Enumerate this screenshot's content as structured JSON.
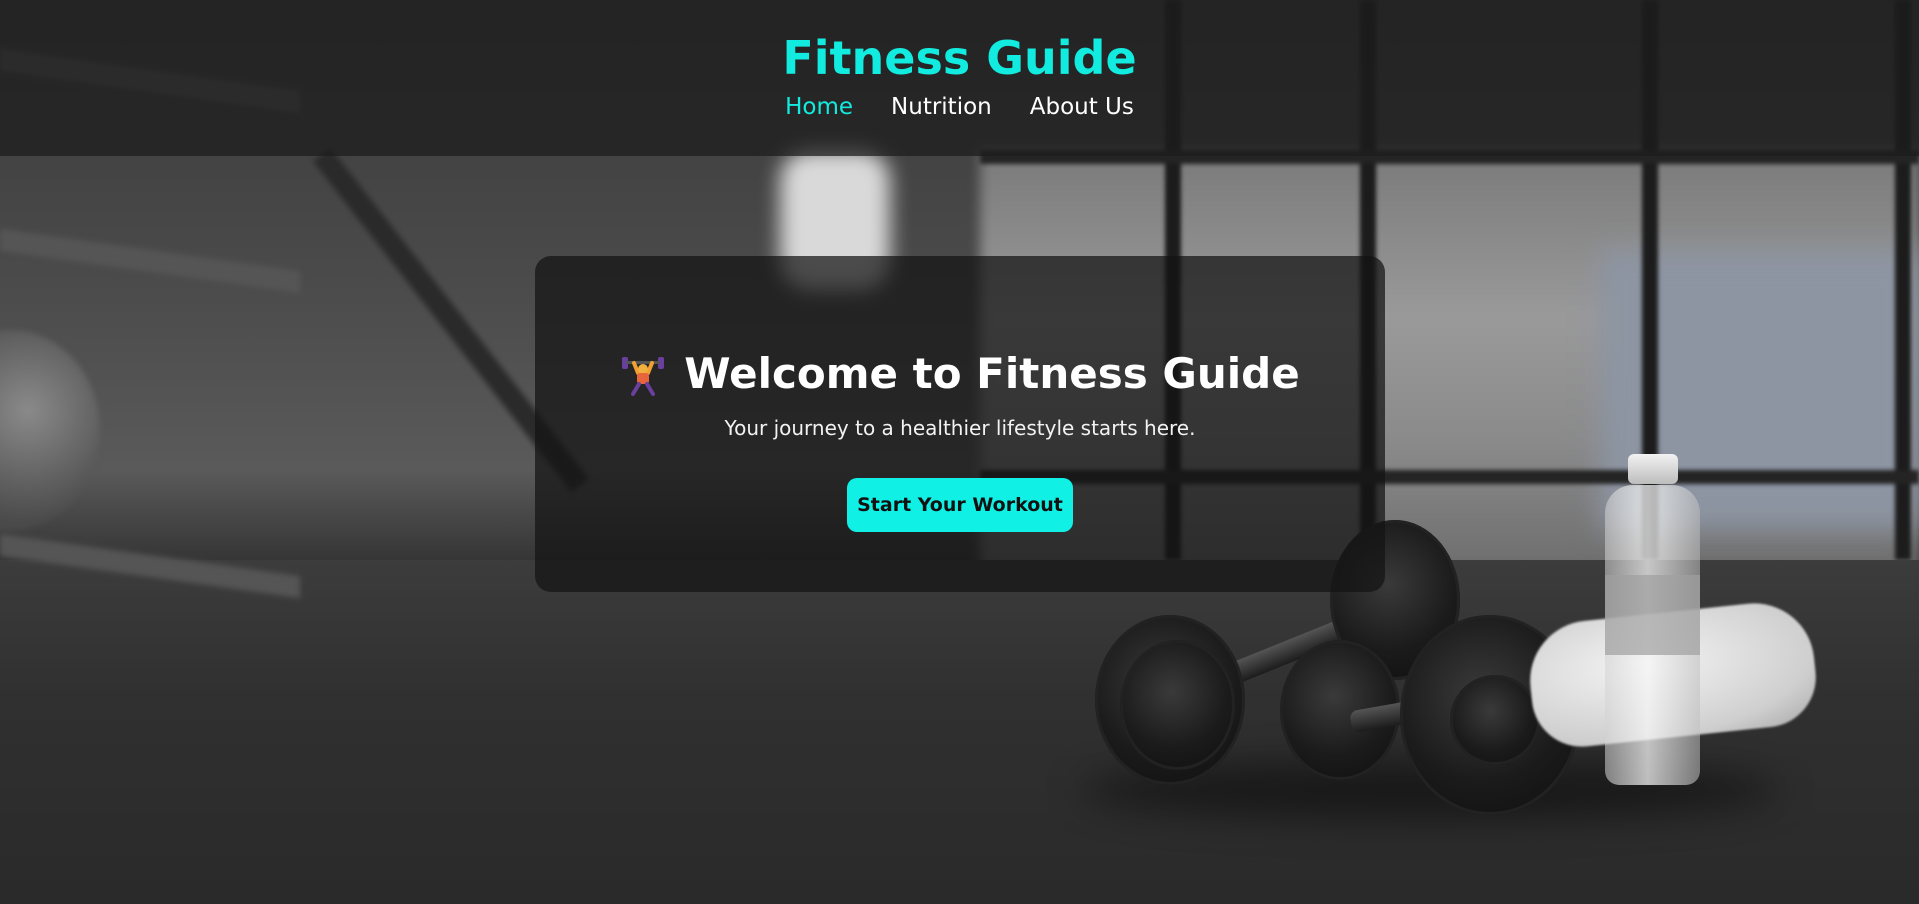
{
  "header": {
    "site_title": "Fitness Guide",
    "nav": [
      {
        "label": "Home",
        "active": true
      },
      {
        "label": "Nutrition",
        "active": false
      },
      {
        "label": "About Us",
        "active": false
      }
    ]
  },
  "hero": {
    "icon": "weightlifter-icon",
    "title": "Welcome to Fitness Guide",
    "subtitle": "Your journey to a healthier lifestyle starts here.",
    "cta_label": "Start Your Workout"
  },
  "colors": {
    "accent": "#12ece0",
    "cta_background": "#10f0e4",
    "text": "#ffffff"
  }
}
